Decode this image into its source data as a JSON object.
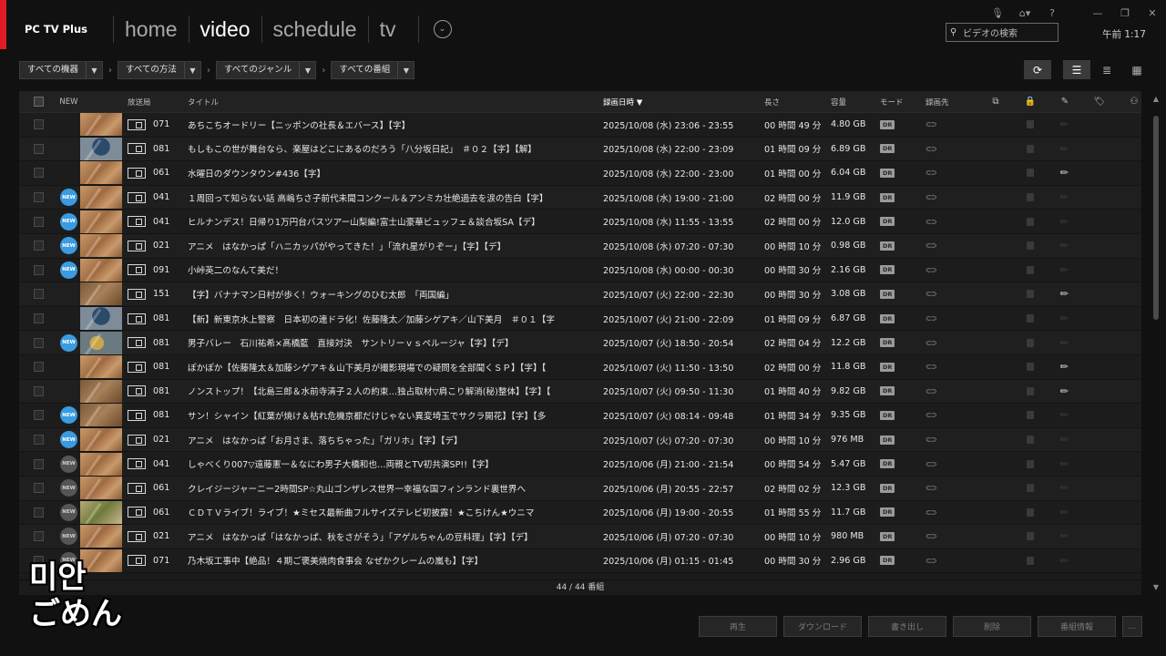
{
  "app": {
    "title": "PC TV Plus"
  },
  "nav": {
    "tabs": [
      {
        "label": "home"
      },
      {
        "label": "video"
      },
      {
        "label": "schedule"
      },
      {
        "label": "tv"
      }
    ],
    "more": "⌄"
  },
  "search": {
    "placeholder": "ビデオの検索"
  },
  "clock": "午前 1:17",
  "filters": [
    "すべての機器",
    "すべての方法",
    "すべてのジャンル",
    "すべての番組"
  ],
  "headers": {
    "new": "NEW",
    "channel": "放送局",
    "title": "タイトル",
    "date": "録画日時 ▼",
    "length": "長さ",
    "size": "容量",
    "mode": "モード",
    "dest": "録画先"
  },
  "rows": [
    {
      "new": false,
      "new_label": "",
      "thumb": "a",
      "ch": "071",
      "title": "あちこちオードリー【ニッポンの社長＆エバース】【字】",
      "date": "2025/10/08 (水) 23:06 - 23:55",
      "len": "00 時間 49 分",
      "size": "4.80 GB",
      "mode": "DR",
      "edit": false
    },
    {
      "new": false,
      "new_label": "",
      "thumb": "blue",
      "ch": "081",
      "title": "もしもこの世が舞台なら、楽屋はどこにあるのだろう「八分坂日記」　＃０２【字】【解】",
      "date": "2025/10/08 (水) 22:00 - 23:09",
      "len": "01 時間 09 分",
      "size": "6.89 GB",
      "mode": "DR",
      "edit": false
    },
    {
      "new": false,
      "new_label": "",
      "thumb": "a",
      "ch": "061",
      "title": "水曜日のダウンタウン#436【字】",
      "date": "2025/10/08 (水) 22:00 - 23:00",
      "len": "01 時間 00 分",
      "size": "6.04 GB",
      "mode": "DR",
      "edit": true
    },
    {
      "new": true,
      "new_label": "NEW",
      "thumb": "a",
      "ch": "041",
      "title": "１周回って知らない話 高嶋ちさ子前代未聞コンクール＆アンミカ壮絶過去を涙の告白【字】",
      "date": "2025/10/08 (水) 19:00 - 21:00",
      "len": "02 時間 00 分",
      "size": "11.9 GB",
      "mode": "DR",
      "edit": false
    },
    {
      "new": true,
      "new_label": "NEW",
      "thumb": "a",
      "ch": "041",
      "title": "ヒルナンデス！日帰り1万円台バスツアー山梨編!富士山豪華ビュッフェ＆談合坂SA【デ】",
      "date": "2025/10/08 (水) 11:55 - 13:55",
      "len": "02 時間 00 分",
      "size": "12.0 GB",
      "mode": "DR",
      "edit": false
    },
    {
      "new": true,
      "new_label": "NEW",
      "thumb": "a",
      "ch": "021",
      "title": "アニメ　はなかっぱ「ハニカッパがやってきた！」「流れ星がりぞー」【字】【デ】",
      "date": "2025/10/08 (水) 07:20 - 07:30",
      "len": "00 時間 10 分",
      "size": "0.98 GB",
      "mode": "DR",
      "edit": false
    },
    {
      "new": true,
      "new_label": "NEW",
      "thumb": "a",
      "ch": "091",
      "title": "小峠英二のなんて美だ！",
      "date": "2025/10/08 (水) 00:00 - 00:30",
      "len": "00 時間 30 分",
      "size": "2.16 GB",
      "mode": "DR",
      "edit": false
    },
    {
      "new": false,
      "new_label": "",
      "thumb": "dark",
      "ch": "151",
      "title": "【字】バナナマン日村が歩く！ウォーキングのひむ太郎　「両国編」",
      "date": "2025/10/07 (火) 22:00 - 22:30",
      "len": "00 時間 30 分",
      "size": "3.08 GB",
      "mode": "DR",
      "edit": true
    },
    {
      "new": false,
      "new_label": "",
      "thumb": "blue",
      "ch": "081",
      "title": "【新】新東京水上警察　日本初の連ドラ化！佐藤隆太／加藤シゲアキ／山下美月　＃０１【字",
      "date": "2025/10/07 (火) 21:00 - 22:09",
      "len": "01 時間 09 分",
      "size": "6.87 GB",
      "mode": "DR",
      "edit": false
    },
    {
      "new": true,
      "new_label": "NEW",
      "thumb": "sun",
      "ch": "081",
      "title": "男子バレー　石川祐希×髙橋藍　直接対決　サントリーｖｓペルージャ【字】【デ】",
      "date": "2025/10/07 (火) 18:50 - 20:54",
      "len": "02 時間 04 分",
      "size": "12.2 GB",
      "mode": "DR",
      "edit": false
    },
    {
      "new": false,
      "new_label": "",
      "thumb": "a",
      "ch": "081",
      "title": "ぽかぽか【佐藤隆太＆加藤シゲアキ＆山下美月が撮影現場での疑問を全部聞くＳＰ】【字】【",
      "date": "2025/10/07 (火) 11:50 - 13:50",
      "len": "02 時間 00 分",
      "size": "11.8 GB",
      "mode": "DR",
      "edit": true
    },
    {
      "new": false,
      "new_label": "",
      "thumb": "dark",
      "ch": "081",
      "title": "ノンストップ！【北島三郎＆水前寺清子２人の約束…独占取材▽肩こり解消(秘)整体】【字】【",
      "date": "2025/10/07 (火) 09:50 - 11:30",
      "len": "01 時間 40 分",
      "size": "9.82 GB",
      "mode": "DR",
      "edit": true
    },
    {
      "new": true,
      "new_label": "NEW",
      "thumb": "dark",
      "ch": "081",
      "title": "サン！シャイン【紅葉が焼け＆枯れ危機京都だけじゃない異変埼玉でサクラ開花】【字】【多",
      "date": "2025/10/07 (火) 08:14 - 09:48",
      "len": "01 時間 34 分",
      "size": "9.35 GB",
      "mode": "DR",
      "edit": false
    },
    {
      "new": true,
      "new_label": "NEW",
      "thumb": "a",
      "ch": "021",
      "title": "アニメ　はなかっぱ「お月さま、落ちちゃった」「ガリホ」【字】【デ】",
      "date": "2025/10/07 (火) 07:20 - 07:30",
      "len": "00 時間 10 分",
      "size": "976 MB",
      "mode": "DR",
      "edit": false
    },
    {
      "new": false,
      "new_label": "NEW",
      "thumb": "a",
      "ch": "041",
      "title": "しゃべくり007▽遠藤憲一＆なにわ男子大橋和也…両親とTV初共演SP!!【字】",
      "date": "2025/10/06 (月) 21:00 - 21:54",
      "len": "00 時間 54 分",
      "size": "5.47 GB",
      "mode": "DR",
      "edit": false
    },
    {
      "new": false,
      "new_label": "NEW",
      "thumb": "a",
      "ch": "061",
      "title": "クレイジージャーニー2時間SP☆丸山ゴンザレス世界一幸福な国フィンランド裏世界へ",
      "date": "2025/10/06 (月) 20:55 - 22:57",
      "len": "02 時間 02 分",
      "size": "12.3 GB",
      "mode": "DR",
      "edit": false
    },
    {
      "new": false,
      "new_label": "NEW",
      "thumb": "green",
      "ch": "061",
      "title": "ＣＤＴＶライブ！ライブ！★ミセス最新曲フルサイズテレビ初披露！★こちけん★ウニマ",
      "date": "2025/10/06 (月) 19:00 - 20:55",
      "len": "01 時間 55 分",
      "size": "11.7 GB",
      "mode": "DR",
      "edit": false
    },
    {
      "new": false,
      "new_label": "NEW",
      "thumb": "a",
      "ch": "021",
      "title": "アニメ　はなかっぱ「はなかっぱ、秋をさがそう」「アゲルちゃんの豆料理」【字】【デ】",
      "date": "2025/10/06 (月) 07:20 - 07:30",
      "len": "00 時間 10 分",
      "size": "980 MB",
      "mode": "DR",
      "edit": false
    },
    {
      "new": false,
      "new_label": "NEW",
      "thumb": "a",
      "ch": "071",
      "title": "乃木坂工事中【絶品！４期ご褒美焼肉食事会 なぜかクレームの嵐も】【字】",
      "date": "2025/10/06 (月) 01:15 - 01:45",
      "len": "00 時間 30 分",
      "size": "2.96 GB",
      "mode": "DR",
      "edit": false
    }
  ],
  "count": "44 / 44 番組",
  "actions": [
    "再生",
    "ダウンロード",
    "書き出し",
    "削除",
    "番組情報",
    "…"
  ],
  "subtitle": {
    "line1": "미안",
    "line2": "ごめん"
  }
}
